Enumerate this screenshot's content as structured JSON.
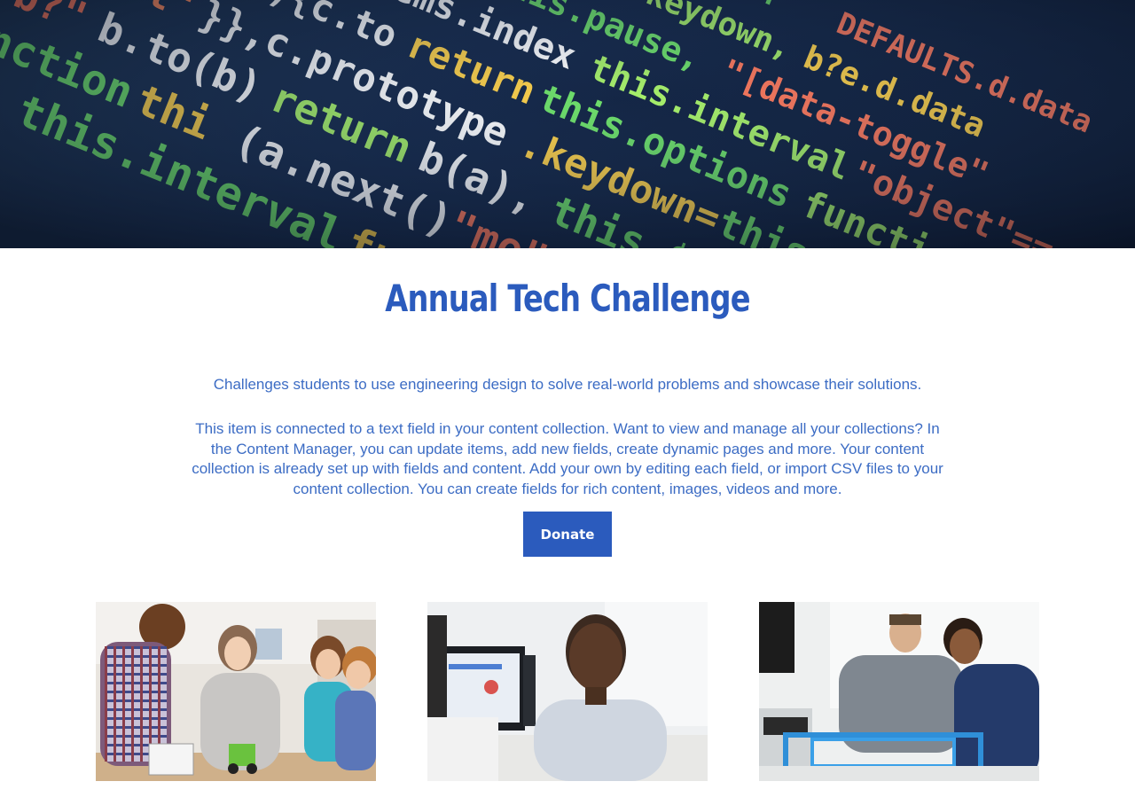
{
  "hero": {
    "icon": "code-background-image"
  },
  "page": {
    "title": "Annual Tech Challenge",
    "tagline": "Challenges students to use engineering design to solve real-world problems and showcase their solutions.",
    "description": "This item is connected to a text field in your content collection. Want to view and manage all your collections? In the Content Manager, you can update items, add new fields, create dynamic pages and more. Your content collection is already set up with fields and content. Add your own by editing each field, or import CSV files to your content collection. You can create fields for rich content, images, videos and more.",
    "donate_label": "Donate"
  },
  "colors": {
    "accent": "#2b5bbd",
    "text": "#3c6cc4"
  },
  "gallery": [
    {
      "icon": "students-robotics-photo"
    },
    {
      "icon": "boy-at-computer-photo"
    },
    {
      "icon": "teacher-student-robot-photo"
    }
  ]
}
